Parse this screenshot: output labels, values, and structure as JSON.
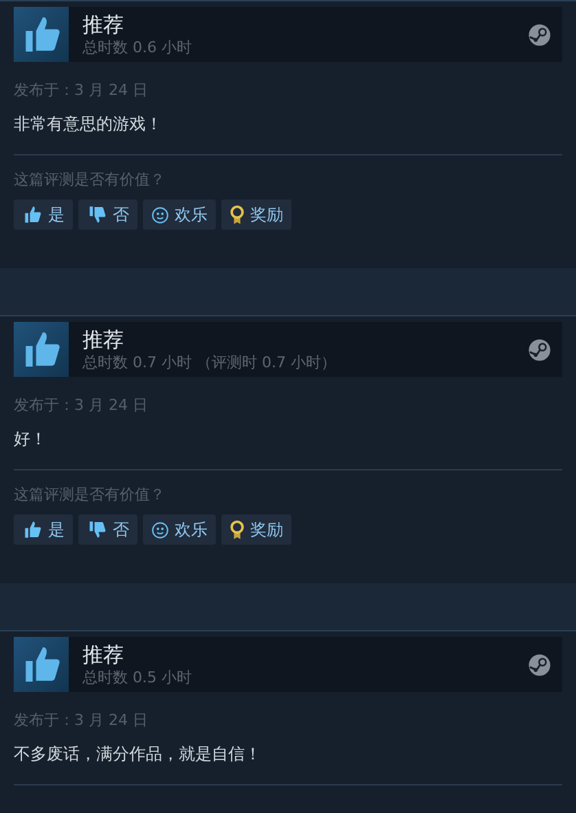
{
  "reviews": [
    {
      "kind": "recommended",
      "title": "推荐",
      "hours": "总时数 0.6 小时",
      "posted": "发布于：3 月 24 日",
      "body": "非常有意思的游戏！",
      "helpful": {
        "question": "这篇评测是否有价值？",
        "buttons": [
          {
            "kind": "yes",
            "label": "是"
          },
          {
            "kind": "no",
            "label": "否"
          },
          {
            "kind": "funny",
            "label": "欢乐"
          },
          {
            "kind": "award",
            "label": "奖励"
          }
        ]
      }
    },
    {
      "kind": "recommended",
      "title": "推荐",
      "hours": "总时数 0.7 小时 （评测时 0.7 小时）",
      "posted": "发布于：3 月 24 日",
      "body": "好！",
      "helpful": {
        "question": "这篇评测是否有价值？",
        "buttons": [
          {
            "kind": "yes",
            "label": "是"
          },
          {
            "kind": "no",
            "label": "否"
          },
          {
            "kind": "funny",
            "label": "欢乐"
          },
          {
            "kind": "award",
            "label": "奖励"
          }
        ]
      }
    },
    {
      "kind": "recommended",
      "title": "推荐",
      "hours": "总时数 0.5 小时",
      "posted": "发布于：3 月 24 日",
      "body": "不多废话，满分作品，就是自信！"
    }
  ]
}
